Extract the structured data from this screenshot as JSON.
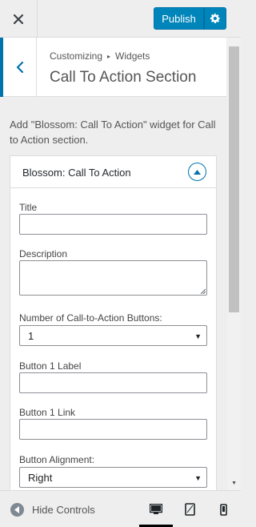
{
  "header": {
    "close_icon": "close-icon",
    "publish_label": "Publish",
    "gear_icon": "gear-icon"
  },
  "section": {
    "breadcrumb_parent": "Customizing",
    "breadcrumb_child": "Widgets",
    "title": "Call To Action Section"
  },
  "description": "Add \"Blossom: Call To Action\" widget for Call to Action section.",
  "widget": {
    "title": "Blossom: Call To Action",
    "fields": {
      "title_label": "Title",
      "title_value": "",
      "description_label": "Description",
      "description_value": "",
      "buttons_count_label": "Number of Call-to-Action Buttons:",
      "buttons_count_value": "1",
      "button1_label_label": "Button 1 Label",
      "button1_label_value": "",
      "button1_link_label": "Button 1 Link",
      "button1_link_value": "",
      "alignment_label": "Button Alignment:",
      "alignment_value": "Right"
    }
  },
  "footer": {
    "hide_controls_label": "Hide Controls",
    "devices": [
      "desktop",
      "tablet",
      "mobile"
    ],
    "active_device": "desktop"
  },
  "colors": {
    "accent": "#0073aa",
    "publish": "#0085ba"
  }
}
